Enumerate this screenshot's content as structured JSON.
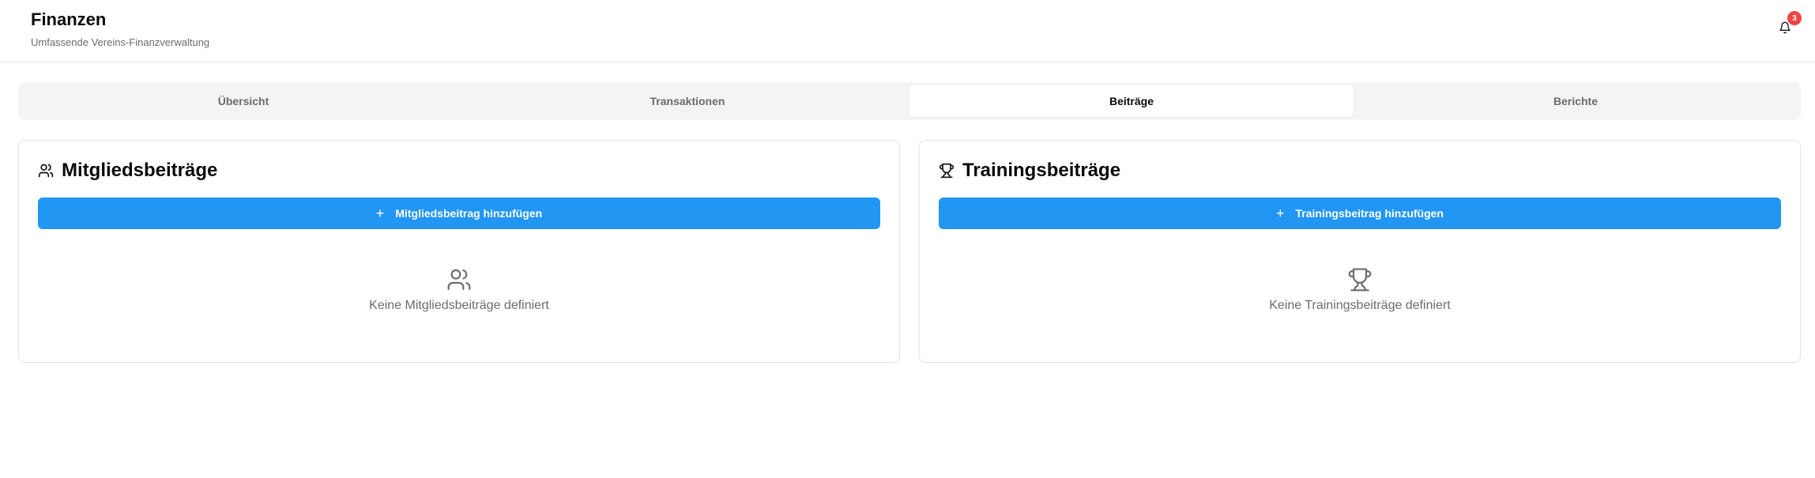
{
  "header": {
    "title": "Finanzen",
    "subtitle": "Umfassende Vereins-Finanzverwaltung",
    "notification_count": "3"
  },
  "tabs": [
    {
      "label": "Übersicht",
      "active": false
    },
    {
      "label": "Transaktionen",
      "active": false
    },
    {
      "label": "Beiträge",
      "active": true
    },
    {
      "label": "Berichte",
      "active": false
    }
  ],
  "membership_card": {
    "icon": "users-icon",
    "title": "Mitgliedsbeiträge",
    "add_button_label": "Mitgliedsbeitrag hinzufügen",
    "empty_text": "Keine Mitgliedsbeiträge definiert"
  },
  "training_card": {
    "icon": "trophy-icon",
    "title": "Trainingsbeiträge",
    "add_button_label": "Trainingsbeitrag hinzufügen",
    "empty_text": "Keine Trainingsbeiträge definiert"
  },
  "colors": {
    "accent": "#2196f3",
    "badge": "#ef4444",
    "tabs_background": "#f4f4f3",
    "muted_text": "#6b6b6b"
  }
}
